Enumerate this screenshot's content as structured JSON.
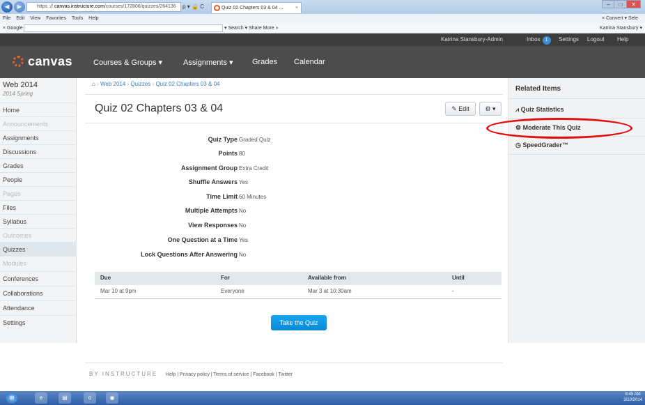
{
  "browser": {
    "url_scheme": "https",
    "url_host": "canvas.instructure.com",
    "url_path": "/courses/172806/quizzes/264136",
    "url_tools": "ρ ▾ 🔒 C",
    "tab_title": "Quiz 02 Chapters 03 & 04 ...",
    "menu": [
      "File",
      "Edit",
      "View",
      "Favorites",
      "Tools",
      "Help"
    ],
    "menu_right": "× Convert ▾  Sele",
    "google_label": "× Google",
    "google_tools": "▾  Search ▾   Share   More »",
    "google_user": "Katrina Stansbury ▾"
  },
  "topbar": {
    "user": "Katrina Stansbury-Admin",
    "inbox": "Inbox",
    "inbox_count": "1",
    "settings": "Settings",
    "logout": "Logout",
    "help": "Help"
  },
  "header": {
    "logo": "canvas",
    "nav": [
      "Courses & Groups ▾",
      "Assignments ▾",
      "Grades",
      "Calendar"
    ]
  },
  "sidebar": {
    "course": "Web 2014",
    "term": "2014 Spring",
    "items": [
      {
        "label": "Home"
      },
      {
        "label": "Announcements"
      },
      {
        "label": "Assignments"
      },
      {
        "label": "Discussions"
      },
      {
        "label": "Grades"
      },
      {
        "label": "People"
      },
      {
        "label": "Pages"
      },
      {
        "label": "Files"
      },
      {
        "label": "Syllabus"
      },
      {
        "label": "Outcomes"
      },
      {
        "label": "Quizzes"
      },
      {
        "label": "Modules"
      },
      {
        "label": "Conferences"
      },
      {
        "label": "Collaborations"
      },
      {
        "label": "Attendance"
      },
      {
        "label": "Settings"
      }
    ]
  },
  "breadcrumb": {
    "items": [
      "Web 2014",
      "Quizzes",
      "Quiz 02 Chapters 03 & 04"
    ]
  },
  "quiz": {
    "title": "Quiz 02 Chapters 03 & 04",
    "edit_label": "Edit",
    "details": [
      {
        "label": "Quiz Type",
        "value": "Graded Quiz"
      },
      {
        "label": "Points",
        "value": "80"
      },
      {
        "label": "Assignment Group",
        "value": "Extra Credit"
      },
      {
        "label": "Shuffle Answers",
        "value": "Yes"
      },
      {
        "label": "Time Limit",
        "value": "60 Minutes"
      },
      {
        "label": "Multiple Attempts",
        "value": "No"
      },
      {
        "label": "View Responses",
        "value": "No"
      },
      {
        "label": "One Question at a Time",
        "value": "Yes"
      },
      {
        "label": "Lock Questions After Answering",
        "value": "No"
      }
    ],
    "table": {
      "headers": [
        "Due",
        "For",
        "Available from",
        "Until"
      ],
      "rows": [
        [
          "Mar 10 at 9pm",
          "Everyone",
          "Mar 3 at 10:30am",
          "-"
        ]
      ]
    },
    "take_label": "Take the Quiz"
  },
  "related": {
    "heading": "Related Items",
    "items": [
      {
        "label": "Quiz Statistics"
      },
      {
        "label": "Moderate This Quiz"
      },
      {
        "label": "SpeedGrader™"
      }
    ]
  },
  "footer": {
    "brand": "BY INSTRUCTURE",
    "links": "Help | Privacy policy | Terms of service | Facebook | Twitter"
  },
  "taskbar": {
    "time": "8:45 AM",
    "date": "3/10/2014"
  },
  "colors": {
    "highlight_oval": "#e20f0f",
    "take_button": "#0c89d6"
  }
}
